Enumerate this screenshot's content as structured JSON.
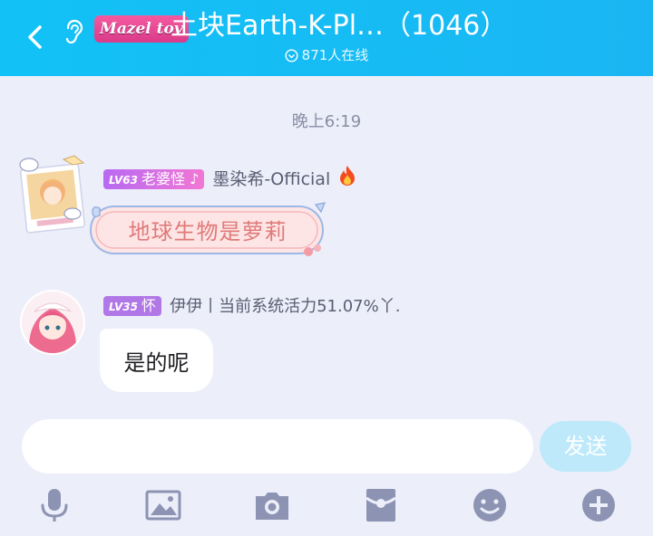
{
  "header": {
    "badge": "Mazel tov",
    "title": "土块Earth-K-Pl…（1046）",
    "online": "871人在线"
  },
  "chat": {
    "time": "晚上6:19",
    "messages": [
      {
        "level": "LV63",
        "title": "老婆怪 ♪",
        "name": "墨染希-Official",
        "text": "地球生物是萝莉"
      },
      {
        "level": "LV35",
        "title": "怀",
        "name": "伊伊丨当前系统活力51.07%丫.",
        "text": "是的呢"
      }
    ]
  },
  "composer": {
    "value": "",
    "send_label": "发送"
  },
  "toolbar": [
    "microphone-icon",
    "image-icon",
    "camera-icon",
    "red-packet-icon",
    "emoji-icon",
    "plus-icon"
  ]
}
